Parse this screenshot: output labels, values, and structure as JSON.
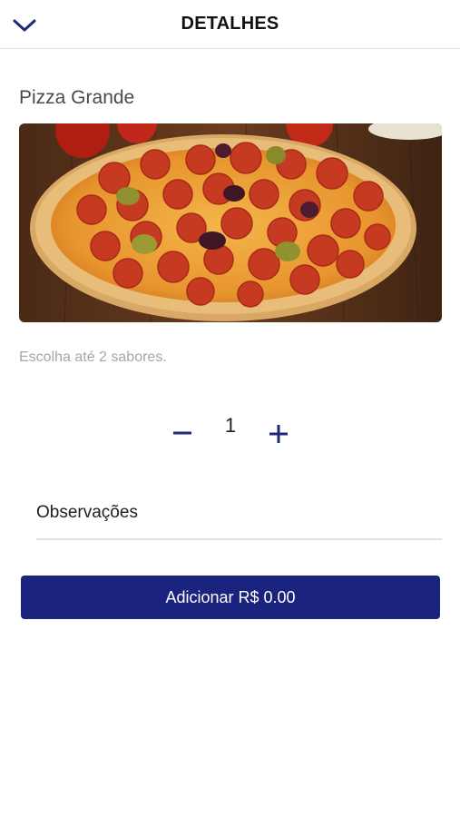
{
  "colors": {
    "accent": "#1a237e",
    "icon": "#1f2a7a",
    "hint_text": "#a6a6a6"
  },
  "header": {
    "title": "DETALHES",
    "back_icon": "chevron-down-icon"
  },
  "product": {
    "name": "Pizza Grande",
    "image": "pepperoni-pizza-photo",
    "flavor_hint": "Escolha até 2 sabores."
  },
  "quantity": {
    "value": "1",
    "decrement_icon": "minus-icon",
    "increment_icon": "plus-icon"
  },
  "notes": {
    "placeholder": "Observações",
    "value": ""
  },
  "add_button": {
    "label": "Adicionar R$ 0.00"
  }
}
